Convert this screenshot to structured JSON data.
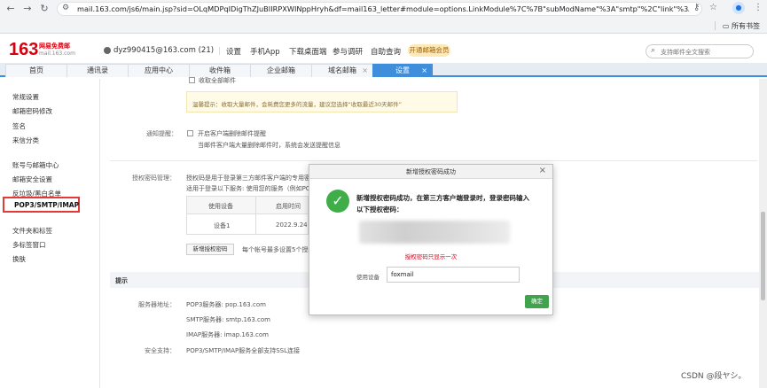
{
  "browser": {
    "url": "mail.163.com/js6/main.jsp?sid=OLqMDPqIDigThZJuBIIRPXWINppHryh&df=mail163_letter#module=options.LinkModule%7C%7B\"subModName\"%3A\"smtp\"%2C\"link\"%3A\"option_...",
    "bookmarks_all": "所有书签"
  },
  "header": {
    "logo_num": "163",
    "logo_text": "网易免费邮",
    "logo_domain": "mail.163.com",
    "user": "dyz990415@163.com (21)",
    "links": [
      "设置",
      "手机App",
      "下载桌面端",
      "参与调研",
      "自助查询"
    ],
    "vip": "开通邮箱会员",
    "search_placeholder": "支持邮件全文搜索"
  },
  "tabs": [
    "首页",
    "通讯录",
    "应用中心",
    "收件箱",
    "企业邮箱",
    "域名邮箱",
    "设置"
  ],
  "sidebar": {
    "items": [
      "常规设置",
      "邮箱密码修改",
      "签名",
      "来信分类",
      "账号与邮箱中心",
      "邮箱安全设置",
      "反垃圾/黑白名单",
      "POP3/SMTP/IMAP",
      "文件夹和标签",
      "多标签窗口",
      "换肤"
    ]
  },
  "main": {
    "top_cut": "收取全部邮件",
    "tip": "温馨提示：收取大量邮件，会耗费您更多的流量，建议您选择“收取最近30天邮件”",
    "notify_label": "通知提醒：",
    "notify_check": "开启客户端删除邮件提醒",
    "notify_desc": "当邮件客户端大量删除邮件时，系统会发送提醒信息",
    "auth_label": "授权密码管理：",
    "auth_desc1": "授权码是用于登录第三方邮件客户端的专用密码",
    "auth_desc2": "适用于登录以下服务: 使用您的服务（例如POP",
    "table_headers": [
      "使用设备",
      "启用时间"
    ],
    "table_row": [
      "设备1",
      "2022.9.24"
    ],
    "add_btn": "新增授权密码",
    "max_note": "每个帐号最多设置5个授权",
    "tip_title": "提示",
    "server_label": "服务器地址：",
    "pop3": "POP3服务器: pop.163.com",
    "smtp": "SMTP服务器: smtp.163.com",
    "imap": "IMAP服务器: imap.163.com",
    "security_label": "安全支持：",
    "security": "POP3/SMTP/IMAP服务全部支持SSL连接"
  },
  "modal": {
    "title": "新增授权密码成功",
    "close": "×",
    "message": "新增授权密码成功，在第三方客户端登录时，登录密码输入以下授权密码：",
    "show_once": "授权密码只显示一次",
    "device_label": "使用设备",
    "device_value": "foxmail",
    "ok": "确定"
  },
  "watermark": "CSDN @段ヤシ。",
  "colors": {
    "accent": "#3f8edc",
    "logo": "#d7000f",
    "success": "#3fae49",
    "highlight_border": "#e53935"
  }
}
